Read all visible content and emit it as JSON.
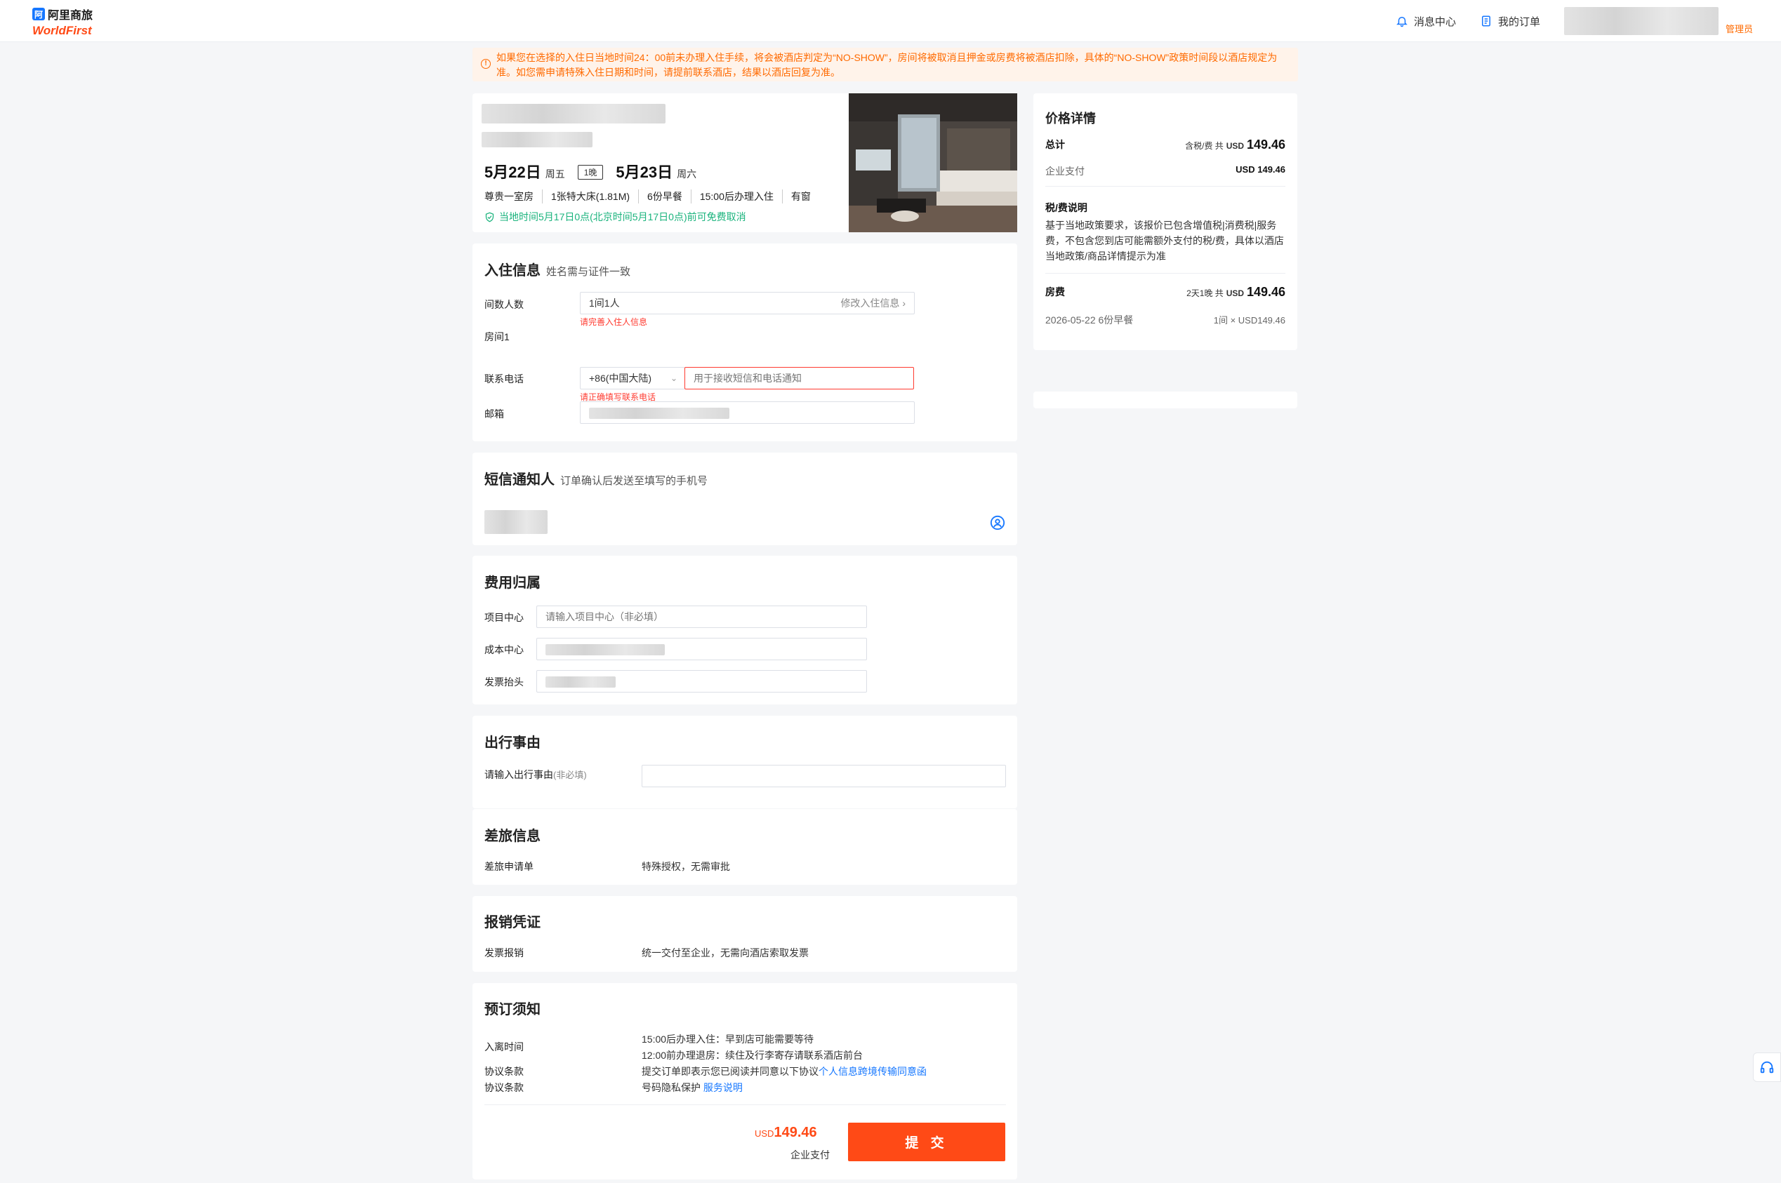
{
  "header": {
    "logo_cn": "阿里商旅",
    "logo_brand": "WorldFirst",
    "messages_label": "消息中心",
    "orders_label": "我的订单",
    "role_badge": "管理员"
  },
  "notice": {
    "text": "如果您在选择的入住日当地时间24：00前未办理入住手续，将会被酒店判定为“NO-SHOW”，房间将被取消且押金或房费将被酒店扣除，具体的“NO-SHOW”政策时间段以酒店规定为准。如您需申请特殊入住日期和时间，请提前联系酒店，结果以酒店回复为准。"
  },
  "hotel": {
    "checkin_date": "5月22日",
    "checkin_weekday": "周五",
    "nights": "1晚",
    "checkout_date": "5月23日",
    "checkout_weekday": "周六",
    "room_features": [
      "尊贵一室房",
      "1张特大床(1.81M)",
      "6份早餐",
      "15:00后办理入住",
      "有窗"
    ],
    "cancel_policy": "当地时间5月17日0点(北京时间5月17日0点)前可免费取消"
  },
  "checkin_info": {
    "title": "入住信息",
    "subtitle": "姓名需与证件一致",
    "rooms_label": "间数人数",
    "rooms_value": "1间1人",
    "edit_label": "修改入住信息",
    "rooms_error": "请完善入住人信息",
    "room1_label": "房间1",
    "phone_label": "联系电话",
    "phone_code": "+86(中国大陆)",
    "phone_placeholder": "用于接收短信和电话通知",
    "phone_error": "请正确填写联系电话",
    "email_label": "邮箱"
  },
  "sms": {
    "title": "短信通知人",
    "subtitle": "订单确认后发送至填写的手机号"
  },
  "cost": {
    "title": "费用归属",
    "project_label": "项目中心",
    "project_placeholder": "请输入项目中心（非必填）",
    "cost_center_label": "成本中心",
    "invoice_label": "发票抬头"
  },
  "trip_reason": {
    "title": "出行事由",
    "label": "请输入出行事由",
    "optional": "(非必填)"
  },
  "travel": {
    "title": "差旅信息",
    "label": "差旅申请单",
    "value": "特殊授权，无需审批"
  },
  "reimburse": {
    "title": "报销凭证",
    "label": "发票报销",
    "value": "统一交付至企业，无需向酒店索取发票"
  },
  "booking_notes": {
    "title": "预订须知",
    "time_label": "入离时间",
    "checkin_note": "15:00后办理入住：早到店可能需要等待",
    "checkout_note": "12:00前办理退房：续住及行李寄存请联系酒店前台",
    "agreement_label": "协议条款",
    "agreement_text": "提交订单即表示您已阅读并同意以下协议",
    "agreement_link": "个人信息跨境传输同意函",
    "privacy_text": "号码隐私保护",
    "privacy_link": "服务说明"
  },
  "footer": {
    "currency": "USD",
    "amount": "149.46",
    "pay_method": "企业支付",
    "submit_label": "提 交"
  },
  "price": {
    "title": "价格详情",
    "total_label": "总计",
    "total_prefix": "含税/费 共",
    "total_currency": "USD",
    "total_amount": "149.46",
    "company_pay_label": "企业支付",
    "company_pay_value": "USD 149.46",
    "tax_title": "税/费说明",
    "tax_text": "基于当地政策要求，该报价已包含增值税|消费税|服务费，不包含您到店可能需额外支付的税/费，具体以酒店当地政策/商品详情提示为准",
    "room_fee_label": "房费",
    "room_fee_prefix": "2天1晚 共",
    "room_fee_currency": "USD",
    "room_fee_amount": "149.46",
    "night_line": "2026-05-22 6份早餐",
    "night_price": "1间 × USD149.46"
  },
  "colors": {
    "accent": "#ff4a16",
    "link": "#1677ff",
    "success": "#19b37c",
    "error": "#ff3b30"
  }
}
